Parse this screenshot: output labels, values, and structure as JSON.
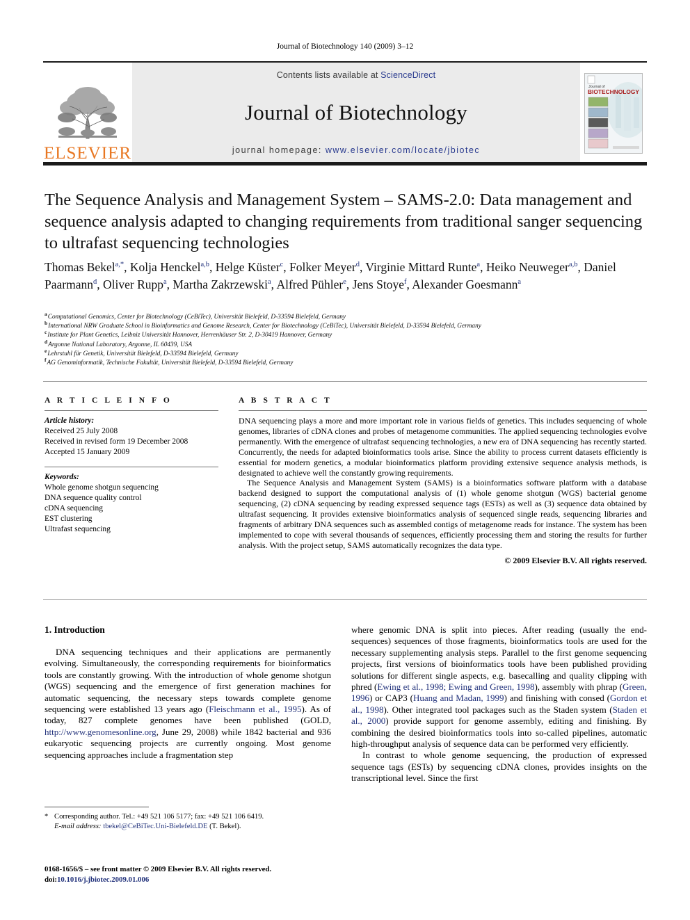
{
  "running_head": "Journal of Biotechnology 140 (2009) 3–12",
  "masthead": {
    "contents_prefix": "Contents lists available at ",
    "contents_link": "ScienceDirect",
    "journal_name": "Journal of Biotechnology",
    "homepage_prefix": "journal homepage: ",
    "homepage_url": "www.elsevier.com/locate/jbiotec",
    "publisher_wordmark": "ELSEVIER",
    "cover_title_small": "Journal of",
    "cover_title_big": "BIOTECHNOLOGY",
    "link_color": "#2a3b8f",
    "elsevier_orange": "#E87722",
    "band_background": "#ebebeb"
  },
  "article": {
    "title": "The Sequence Analysis and Management System – SAMS-2.0: Data management and sequence analysis adapted to changing requirements from traditional sanger sequencing to ultrafast sequencing technologies",
    "authors": [
      {
        "name": "Thomas Bekel",
        "marks": "a,*"
      },
      {
        "name": "Kolja Henckel",
        "marks": "a,b"
      },
      {
        "name": "Helge Küster",
        "marks": "c"
      },
      {
        "name": "Folker Meyer",
        "marks": "d"
      },
      {
        "name": "Virginie Mittard Runte",
        "marks": "a"
      },
      {
        "name": "Heiko Neuweger",
        "marks": "a,b"
      },
      {
        "name": "Daniel Paarmann",
        "marks": "d"
      },
      {
        "name": "Oliver Rupp",
        "marks": "a"
      },
      {
        "name": "Martha Zakrzewski",
        "marks": "a"
      },
      {
        "name": "Alfred Pühler",
        "marks": "e"
      },
      {
        "name": "Jens Stoye",
        "marks": "f"
      },
      {
        "name": "Alexander Goesmann",
        "marks": "a"
      }
    ],
    "affiliations": [
      {
        "marker": "a",
        "text": "Computational Genomics, Center for Biotechnology (CeBiTec), Universität Bielefeld, D-33594 Bielefeld, Germany"
      },
      {
        "marker": "b",
        "text": "International NRW Graduate School in Bioinformatics and Genome Research, Center for Biotechnology (CeBiTec), Universität Bielefeld, D-33594 Bielefeld, Germany"
      },
      {
        "marker": "c",
        "text": "Institute for Plant Genetics, Leibniz Universität Hannover, Herrenhäuser Str. 2, D-30419 Hannover, Germany"
      },
      {
        "marker": "d",
        "text": "Argonne National Laboratory, Argonne, IL 60439, USA"
      },
      {
        "marker": "e",
        "text": "Lehrstuhl für Genetik, Universität Bielefeld, D-33594 Bielefeld, Germany"
      },
      {
        "marker": "f",
        "text": "AG Genominformatik, Technische Fakultät, Universität Bielefeld, D-33594 Bielefeld, Germany"
      }
    ]
  },
  "article_info": {
    "heading": "A R T I C L E   I N F O",
    "history_label": "Article history:",
    "history": [
      "Received 25 July 2008",
      "Received in revised form 19 December 2008",
      "Accepted 15 January 2009"
    ],
    "keywords_label": "Keywords:",
    "keywords": [
      "Whole genome shotgun sequencing",
      "DNA sequence quality control",
      "cDNA sequencing",
      "EST clustering",
      "Ultrafast sequencing"
    ]
  },
  "abstract": {
    "heading": "A B S T R A C T",
    "paragraphs": [
      "DNA sequencing plays a more and more important role in various fields of genetics. This includes sequencing of whole genomes, libraries of cDNA clones and probes of metagenome communities. The applied sequencing technologies evolve permanently. With the emergence of ultrafast sequencing technologies, a new era of DNA sequencing has recently started. Concurrently, the needs for adapted bioinformatics tools arise. Since the ability to process current datasets efficiently is essential for modern genetics, a modular bioinformatics platform providing extensive sequence analysis methods, is designated to achieve well the constantly growing requirements.",
      "The Sequence Analysis and Management System (SAMS) is a bioinformatics software platform with a database backend designed to support the computational analysis of (1) whole genome shotgun (WGS) bacterial genome sequencing, (2) cDNA sequencing by reading expressed sequence tags (ESTs) as well as (3) sequence data obtained by ultrafast sequencing. It provides extensive bioinformatics analysis of sequenced single reads, sequencing libraries and fragments of arbitrary DNA sequences such as assembled contigs of metagenome reads for instance. The system has been implemented to cope with several thousands of sequences, efficiently processing them and storing the results for further analysis. With the project setup, SAMS automatically recognizes the data type."
    ],
    "copyright": "© 2009 Elsevier B.V. All rights reserved."
  },
  "body": {
    "section_heading": "1.  Introduction",
    "left_paragraph_parts": {
      "p1_a": "DNA sequencing techniques and their applications are permanently evolving. Simultaneously, the corresponding requirements for bioinformatics tools are constantly growing. With the introduction of whole genome shotgun (WGS) sequencing and the emergence of first generation machines for automatic sequencing, the necessary steps towards complete genome sequencing were established 13 years ago (",
      "cite1": "Fleischmann et al., 1995",
      "p1_b": "). As of today, 827 complete genomes have been published (GOLD, ",
      "link1": "http://www.genomesonline.org",
      "p1_c": ", June 29, 2008) while 1842 bacterial and 936 eukaryotic sequencing projects are currently ongoing. Most genome sequencing approaches include a fragmentation step"
    },
    "right_paragraph_parts": {
      "p2_a": "where genomic DNA is split into pieces. After reading (usually the end-sequences) sequences of those fragments, bioinformatics tools are used for the necessary supplementing analysis steps. Parallel to the first genome sequencing projects, first versions of bioinformatics tools have been published providing solutions for different single aspects, e.g. basecalling and quality clipping with phred (",
      "cite2": "Ewing et al., 1998; Ewing and Green, 1998",
      "p2_b": "), assembly with phrap (",
      "cite3": "Green, 1996",
      "p2_c": ") or CAP3 (",
      "cite4": "Huang and Madan, 1999",
      "p2_d": ") and finishing with consed (",
      "cite5": "Gordon et al., 1998",
      "p2_e": "). Other integrated tool packages such as the Staden system (",
      "cite6": "Staden et al., 2000",
      "p2_f": ") provide support for genome assembly, editing and finishing. By combining the desired bioinformatics tools into so-called pipelines, automatic high-throughput analysis of sequence data can be performed very efficiently.",
      "p3": "In contrast to whole genome sequencing, the production of expressed sequence tags (ESTs) by sequencing cDNA clones, provides insights on the transcriptional level. Since the first"
    }
  },
  "footnotes": {
    "star": "*",
    "corresponding": "Corresponding author. Tel.: +49 521 106 5177; fax: +49 521 106 6419.",
    "email_label": "E-mail address:",
    "email": "tbekel@CeBiTec.Uni-Bielefeld.DE",
    "email_suffix": "(T. Bekel)."
  },
  "imprint": {
    "line1": "0168-1656/$ – see front matter © 2009 Elsevier B.V. All rights reserved.",
    "doi_label": "doi:",
    "doi": "10.1016/j.jbiotec.2009.01.006"
  }
}
